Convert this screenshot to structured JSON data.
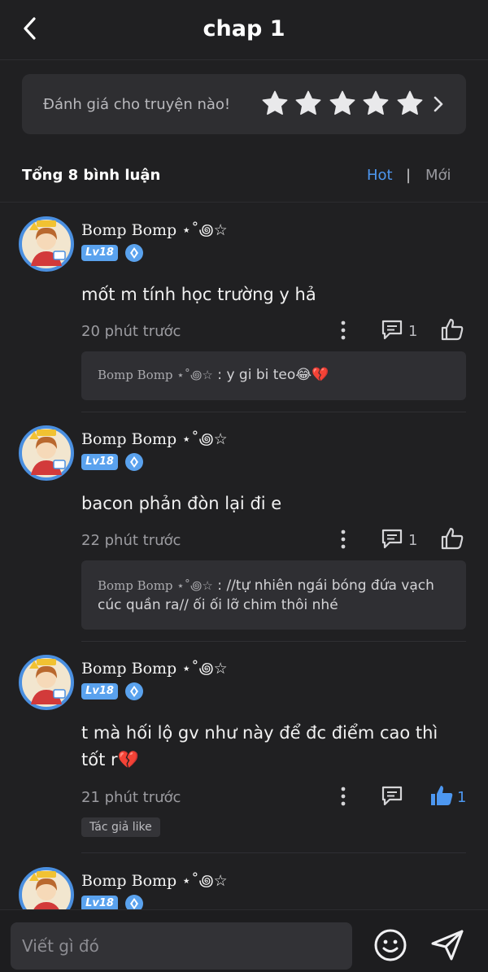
{
  "header": {
    "title": "chap 1",
    "back_icon": "chevron-left-icon"
  },
  "rating": {
    "prompt": "Đánh giá cho truyện nào!",
    "stars": 5,
    "chevron_icon": "chevron-right-icon"
  },
  "comments_header": {
    "count_label": "Tổng 8 bình luận",
    "sort_hot": "Hot",
    "sort_separator": "|",
    "sort_new": "Mới",
    "active_sort": "Hot"
  },
  "comments": [
    {
      "user": "Bomp Bomp ⋆˚꩜☆",
      "level": "Lv18",
      "text": "mốt m tính học trường y hả",
      "time": "20 phút trước",
      "reply_count": "1",
      "like_count": "",
      "liked": false,
      "reply": {
        "user": "Bomp Bomp ⋆˚꩜☆",
        "sep": " : ",
        "text": "y gi bi teo😂💔"
      }
    },
    {
      "user": "Bomp Bomp ⋆˚꩜☆",
      "level": "Lv18",
      "text": "bacon phản đòn lại đi e",
      "time": "22 phút trước",
      "reply_count": "1",
      "like_count": "",
      "liked": false,
      "reply": {
        "user": "Bomp Bomp ⋆˚꩜☆",
        "sep": " : ",
        "text": "//tự nhiên ngái bóng đứa vạch cúc quần ra// ối ối lỡ chim thôi nhé"
      }
    },
    {
      "user": "Bomp Bomp ⋆˚꩜☆",
      "level": "Lv18",
      "text": "t mà hối lộ gv như này để đc điểm cao thì tốt r💔",
      "time": "21 phút trước",
      "reply_count": "",
      "like_count": "1",
      "liked": true,
      "author_like": "Tác giả like"
    },
    {
      "user": "Bomp Bomp ⋆˚꩜☆",
      "level": "Lv18"
    }
  ],
  "composer": {
    "placeholder": "Viết gì đó",
    "emoji_icon": "smiley-icon",
    "send_icon": "send-icon"
  },
  "colors": {
    "background": "#202022",
    "card": "#2e2e31",
    "accent": "#4d97f0",
    "level_badge": "#5aa2ee"
  }
}
